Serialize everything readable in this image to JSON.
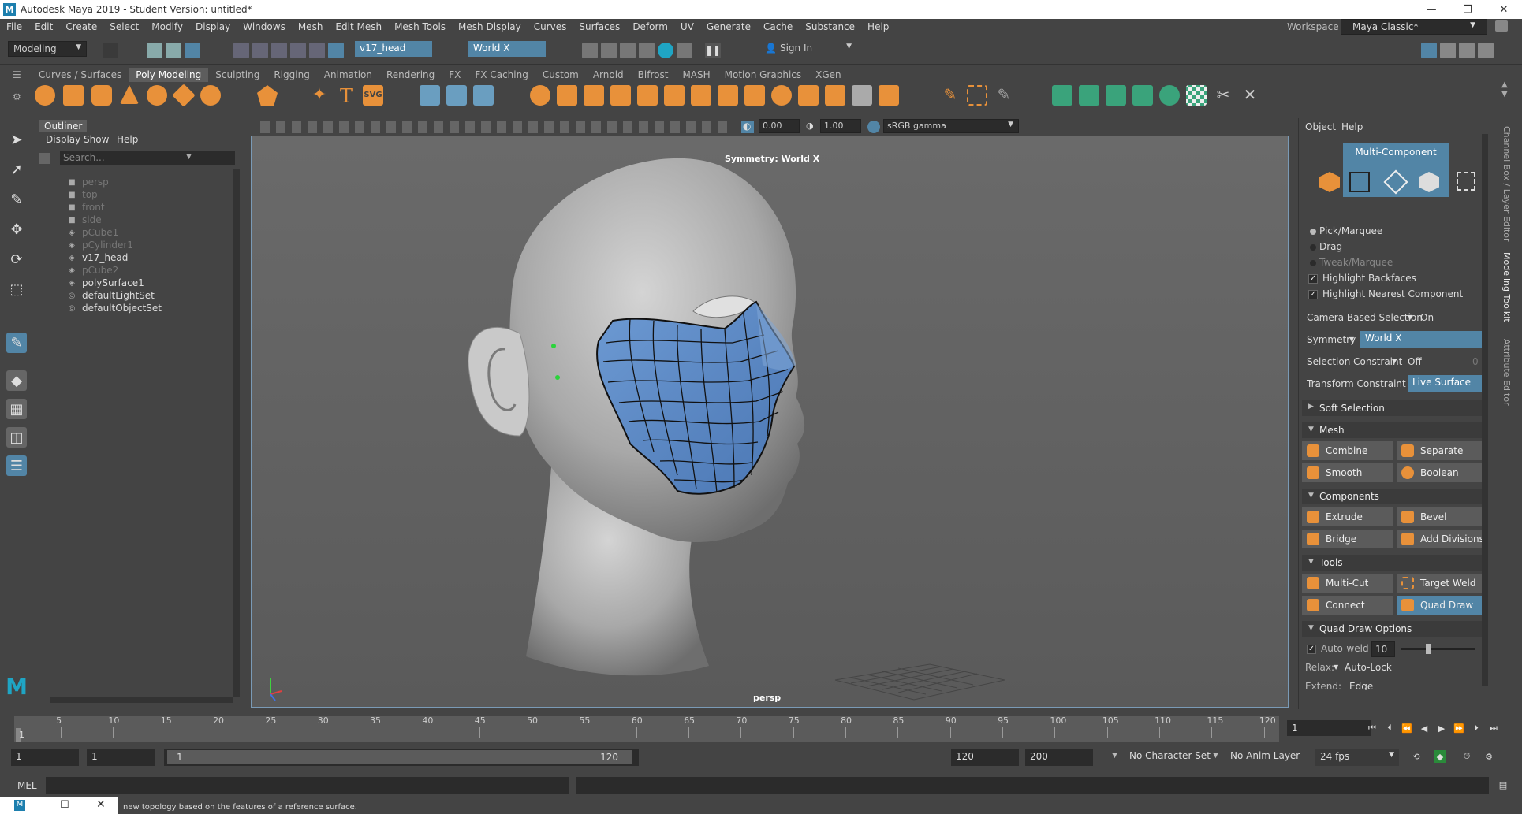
{
  "window": {
    "title": "Autodesk Maya 2019 - Student Version: untitled*",
    "logo": "M"
  },
  "menu": [
    "File",
    "Edit",
    "Create",
    "Select",
    "Modify",
    "Display",
    "Windows",
    "Mesh",
    "Edit Mesh",
    "Mesh Tools",
    "Mesh Display",
    "Curves",
    "Surfaces",
    "Deform",
    "UV",
    "Generate",
    "Cache",
    "Substance",
    "Help"
  ],
  "workspace": {
    "label": "Workspace :",
    "value": "Maya Classic*"
  },
  "statusline": {
    "mode": "Modeling",
    "object_field": "v17_head",
    "symmetry_field": "World X",
    "sign_in": "Sign In"
  },
  "shelf": {
    "tabs": [
      "Curves / Surfaces",
      "Poly Modeling",
      "Sculpting",
      "Rigging",
      "Animation",
      "Rendering",
      "FX",
      "FX Caching",
      "Custom",
      "Arnold",
      "Bifrost",
      "MASH",
      "Motion Graphics",
      "XGen"
    ],
    "active_tab": "Poly Modeling",
    "svg_label": "SVG",
    "text_label": "T"
  },
  "outliner": {
    "title": "Outliner",
    "menu": [
      "Display",
      "Show",
      "Help"
    ],
    "search_placeholder": "Search...",
    "items": [
      {
        "label": "persp",
        "icon": "camera-icon",
        "dim": true
      },
      {
        "label": "top",
        "icon": "camera-icon",
        "dim": true
      },
      {
        "label": "front",
        "icon": "camera-icon",
        "dim": true
      },
      {
        "label": "side",
        "icon": "camera-icon",
        "dim": true
      },
      {
        "label": "pCube1",
        "icon": "mesh-icon",
        "dim": true
      },
      {
        "label": "pCylinder1",
        "icon": "mesh-icon",
        "dim": true
      },
      {
        "label": "v17_head",
        "icon": "mesh-icon",
        "dim": false
      },
      {
        "label": "pCube2",
        "icon": "mesh-icon",
        "dim": true
      },
      {
        "label": "polySurface1",
        "icon": "mesh-icon",
        "dim": false
      },
      {
        "label": "defaultLightSet",
        "icon": "set-icon",
        "dim": false
      },
      {
        "label": "defaultObjectSet",
        "icon": "set-icon",
        "dim": false
      }
    ]
  },
  "viewport": {
    "exposure": "0.00",
    "gamma": "1.00",
    "colorspace": "sRGB gamma",
    "symmetry_label": "Symmetry: World X",
    "camera_label": "persp"
  },
  "toolkit": {
    "menu": [
      "Object",
      "Help"
    ],
    "mode_label": "Multi-Component",
    "selection_modes": [
      "Pick/Marquee",
      "Drag",
      "Tweak/Marquee"
    ],
    "highlight_backfaces": "Highlight Backfaces",
    "highlight_nearest": "Highlight Nearest Component",
    "camera_based": {
      "label": "Camera Based Selection",
      "value": "On"
    },
    "symmetry": {
      "label": "Symmetry",
      "value": "World X"
    },
    "selection_constraint": {
      "label": "Selection Constraint",
      "value": "Off",
      "num": "0"
    },
    "transform_constraint": {
      "label": "Transform Constraint",
      "value": "Live Surface"
    },
    "soft_selection": "Soft Selection",
    "sections": {
      "mesh": "Mesh",
      "components": "Components",
      "tools": "Tools",
      "quad_draw": "Quad Draw Options"
    },
    "mesh_buttons": [
      "Combine",
      "Separate",
      "Smooth",
      "Boolean"
    ],
    "component_buttons": [
      "Extrude",
      "Bevel",
      "Bridge",
      "Add Divisions"
    ],
    "tool_buttons": [
      "Multi-Cut",
      "Target Weld",
      "Connect",
      "Quad Draw"
    ],
    "active_tool": "Quad Draw",
    "auto_weld": {
      "label": "Auto-weld",
      "value": "10",
      "slider_fraction": 0.35
    },
    "relax": {
      "label": "Relax:",
      "value": "Auto-Lock"
    },
    "extend": {
      "label": "Extend:",
      "value": "Edge"
    }
  },
  "side_tabs": [
    "Channel Box / Layer Editor",
    "Modeling Toolkit",
    "Attribute Editor"
  ],
  "timeline": {
    "ticks": [
      "5",
      "10",
      "15",
      "20",
      "25",
      "30",
      "35",
      "40",
      "45",
      "50",
      "55",
      "60",
      "65",
      "70",
      "75",
      "80",
      "85",
      "90",
      "95",
      "100",
      "105",
      "110",
      "115",
      "120"
    ],
    "start_mark": "1",
    "current_frame": "1"
  },
  "range": {
    "start": "1",
    "start2": "1",
    "range_start": "1",
    "range_end": "120",
    "end": "120",
    "end2": "200",
    "character_set": "No Character Set",
    "anim_layer": "No Anim Layer",
    "fps": "24 fps"
  },
  "command": {
    "mel_label": "MEL"
  },
  "help_line": "new topology based on the features of a reference surface."
}
